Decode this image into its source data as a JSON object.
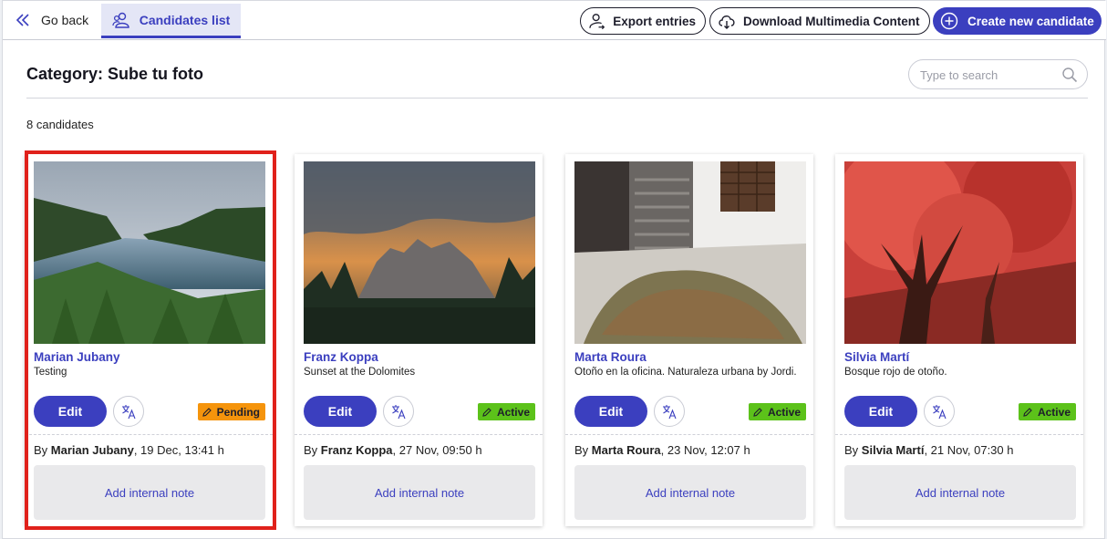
{
  "colors": {
    "accent": "#3b3fbf",
    "pending": "#f5940c",
    "active": "#5cc21a",
    "highlight": "#e0211b"
  },
  "topbar": {
    "back_label": "Go back",
    "tab_label": "Candidates list",
    "export_label": "Export entries",
    "download_label": "Download Multimedia Content",
    "create_label": "Create new candidate"
  },
  "header": {
    "title": "Category: Sube tu foto",
    "search_placeholder": "Type to search",
    "count": "8 candidates"
  },
  "cards": [
    {
      "name": "Marian Jubany",
      "desc": "Testing",
      "status": "Pending",
      "author": "Marian Jubany",
      "date": ", 19 Dec, 13:41 h",
      "edit": "Edit",
      "by": "By ",
      "note": "Add internal note",
      "photo": "lake-forest"
    },
    {
      "name": "Franz Koppa",
      "desc": "Sunset at the Dolomites",
      "status": "Active",
      "author": "Franz Koppa",
      "date": ", 27 Nov, 09:50 h",
      "edit": "Edit",
      "by": "By ",
      "note": "Add internal note",
      "photo": "mountain-sunset"
    },
    {
      "name": "Marta Roura",
      "desc": "Otoño en la oficina. Naturaleza urbana by Jordi.",
      "status": "Active",
      "author": "Marta Roura",
      "date": ", 23 Nov, 12:07 h",
      "edit": "Edit",
      "by": "By ",
      "note": "Add internal note",
      "photo": "office-leaves"
    },
    {
      "name": "Silvia Martí",
      "desc": "Bosque rojo de otoño.",
      "status": "Active",
      "author": "Silvia Martí",
      "date": ", 21 Nov, 07:30 h",
      "edit": "Edit",
      "by": "By ",
      "note": "Add internal note",
      "photo": "red-tree"
    }
  ]
}
